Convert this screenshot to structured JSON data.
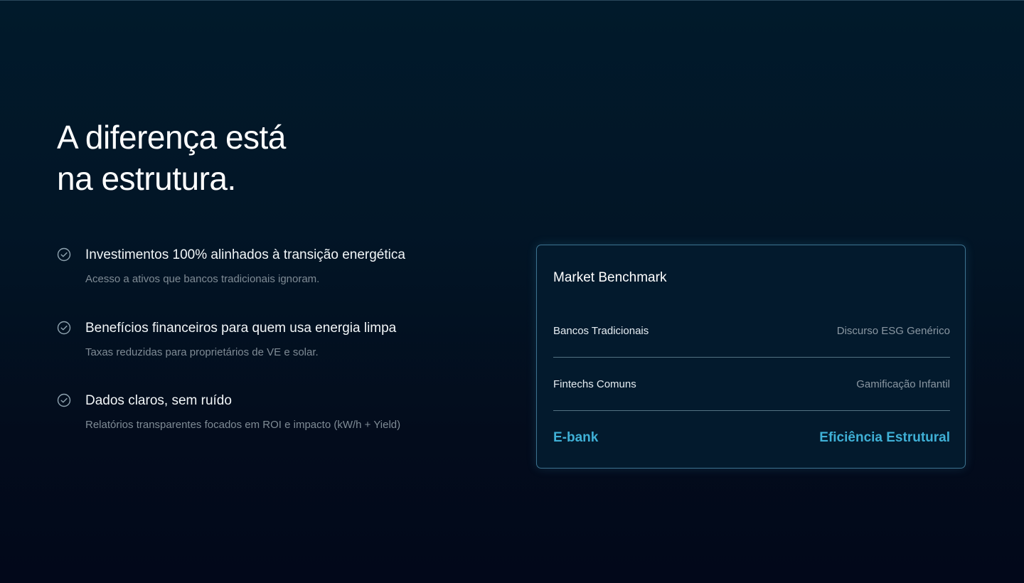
{
  "headline": {
    "line1": "A diferença está",
    "line2": "na estrutura."
  },
  "features": [
    {
      "icon": "check-circle-icon",
      "title": "Investimentos 100% alinhados à transição energética",
      "description": "Acesso a ativos que bancos tradicionais ignoram."
    },
    {
      "icon": "check-circle-icon",
      "title": "Benefícios financeiros para quem usa energia limpa",
      "description": "Taxas reduzidas para proprietários de VE e solar."
    },
    {
      "icon": "check-circle-icon",
      "title": "Dados claros, sem ruído",
      "description": "Relatórios transparentes focados em ROI e impacto (kW/h + Yield)"
    }
  ],
  "benchmark": {
    "title": "Market Benchmark",
    "rows": [
      {
        "label": "Bancos Tradicionais",
        "value": "Discurso ESG Genérico"
      },
      {
        "label": "Fintechs Comuns",
        "value": "Gamificação Infantil"
      },
      {
        "label": "E-bank",
        "value": "Eficiência Estrutural"
      }
    ]
  },
  "colors": {
    "accent": "#3fb0d6",
    "background": "#021526",
    "muted_text": "#7f8b95",
    "card_border": "#6ebee1"
  }
}
